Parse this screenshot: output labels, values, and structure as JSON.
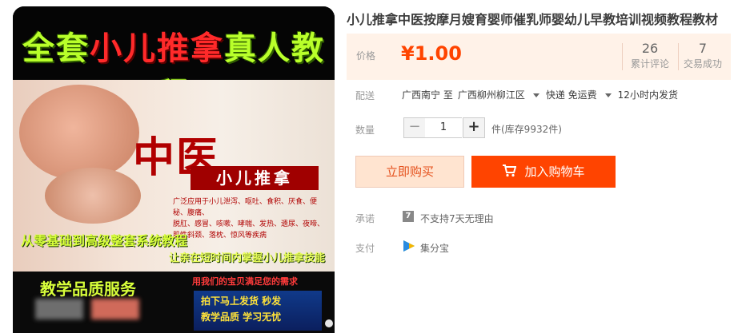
{
  "image": {
    "banner_part1": "全套",
    "banner_part2": "小儿推拿",
    "banner_part3": "真人教程",
    "big_title": "中医",
    "sub_title": "小儿推拿",
    "desc_lines": [
      "广泛应用于小儿泄泻、呕吐、食积、厌食、便秘、腹痛、",
      "脱肛、感冒、咳嗽、哮喘、发热、遗尿、夜啼、",
      "肌性斜颈、落枕、惊风等疾病"
    ],
    "slogan1": "从零基础到高级整套系统教程",
    "slogan2": "让亲在短时间内掌握小儿推拿技能",
    "service": "教学品质服务",
    "service_note": "用我们的宝贝满足您的需求",
    "tag_line1": "拍下马上发货  秒发",
    "tag_line2": "教学品质  学习无忧"
  },
  "product": {
    "title": "小儿推拿中医按摩月嫂育婴师催乳师婴幼儿早教培训视频教程教材",
    "price_label": "价格",
    "price": "¥1.00",
    "reviews_count": "26",
    "reviews_label": "累计评论",
    "deals_count": "7",
    "deals_label": "交易成功"
  },
  "shipping": {
    "label": "配送",
    "from": "广西南宁 至",
    "to": "广西柳州柳江区",
    "method": "快递 免运费",
    "time": "12小时内发货"
  },
  "quantity": {
    "label": "数量",
    "minus": "−",
    "value": "1",
    "plus": "+",
    "stock": "件(库存9932件)"
  },
  "actions": {
    "buy_now": "立即购买",
    "add_cart": "加入购物车"
  },
  "promise": {
    "label": "承诺",
    "icon_glyph": "7",
    "text": "不支持7天无理由"
  },
  "payment": {
    "label": "支付",
    "text": "集分宝"
  },
  "colors": {
    "accent": "#ff4400",
    "price": "#ff4400",
    "price_bg": "#fff2e8"
  }
}
